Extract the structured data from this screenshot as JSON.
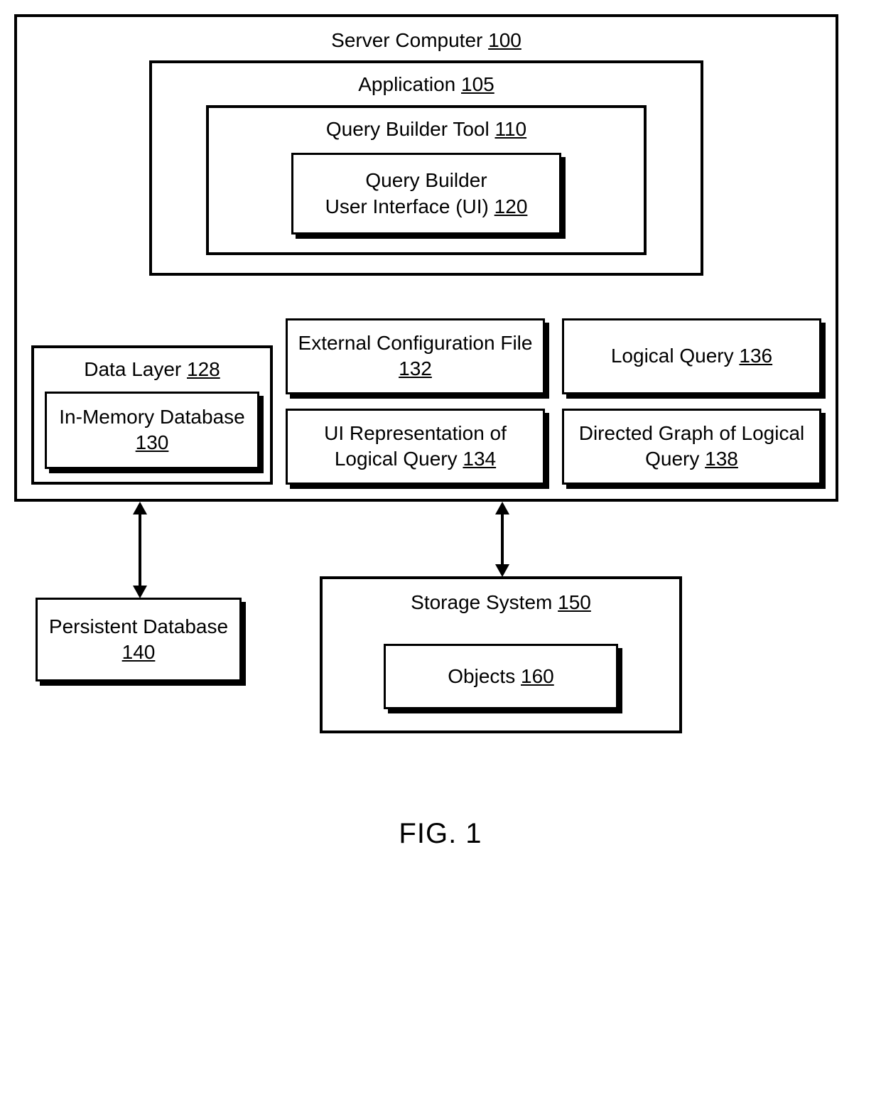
{
  "server": {
    "label": "Server Computer",
    "ref": "100"
  },
  "application": {
    "label": "Application",
    "ref": "105"
  },
  "qbt": {
    "label": "Query Builder Tool",
    "ref": "110"
  },
  "qbui": {
    "line1": "Query Builder",
    "line2": "User Interface (UI)",
    "ref": "120"
  },
  "dataLayer": {
    "label": "Data Layer",
    "ref": "128"
  },
  "inMem": {
    "label": "In-Memory Database",
    "ref": "130"
  },
  "extConfig": {
    "label": "External Configuration File",
    "ref": "132"
  },
  "uiRep": {
    "line1": "UI Representation of",
    "line2": "Logical Query",
    "ref": "134"
  },
  "logicalQuery": {
    "label": "Logical Query",
    "ref": "136"
  },
  "dirGraph": {
    "line1": "Directed Graph of Logical",
    "line2": "Query",
    "ref": "138"
  },
  "persist": {
    "label": "Persistent Database",
    "ref": "140"
  },
  "storage": {
    "label": "Storage System",
    "ref": "150"
  },
  "objects": {
    "label": "Objects",
    "ref": "160"
  },
  "figLabel": "FIG. 1"
}
